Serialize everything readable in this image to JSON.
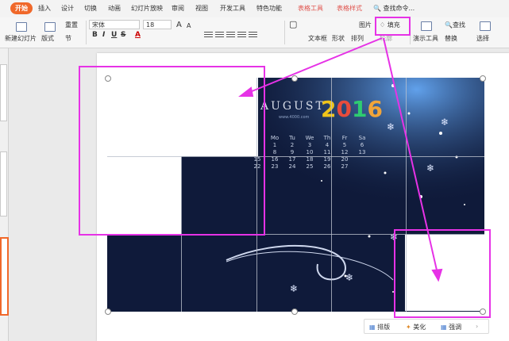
{
  "menu": {
    "items": [
      "开始",
      "插入",
      "设计",
      "切换",
      "动画",
      "幻灯片放映",
      "审阅",
      "视图",
      "开发工具",
      "特色功能"
    ],
    "context_tabs": [
      "表格工具",
      "表格样式"
    ],
    "search": "查找命令..."
  },
  "toolbar": {
    "new_slide": "新建幻灯片",
    "layout": "版式",
    "reset": "重置",
    "section": "节",
    "font_name": "宋体",
    "font_size": "18",
    "textbox": "文本框",
    "shape": "形状",
    "arrange": "排列",
    "picture": "图片",
    "fill": "填充",
    "outline": "轮廓",
    "presenter_tools": "演示工具",
    "find": "查找",
    "replace": "替换",
    "select": "选择"
  },
  "calendar": {
    "month": "AUGUST",
    "year": [
      "2",
      "0",
      "1",
      "6"
    ],
    "site": "www.4000.com",
    "weekdays": [
      "Mo",
      "Tu",
      "We",
      "Th",
      "Fr",
      "Sa"
    ],
    "rows": [
      [
        "1",
        "2",
        "3",
        "4",
        "5",
        "6"
      ],
      [
        "8",
        "9",
        "10",
        "11",
        "12",
        "13"
      ],
      [
        "15",
        "16",
        "17",
        "18",
        "19",
        "20"
      ],
      [
        "22",
        "23",
        "24",
        "25",
        "26",
        "27"
      ]
    ]
  },
  "bottom_bar": {
    "layout": "排版",
    "beautify": "美化",
    "emphasis": "强调"
  },
  "colors": {
    "accent": "#f0682a",
    "highlight": "#e632e6",
    "calendar_bg": "#0f1a3a"
  }
}
